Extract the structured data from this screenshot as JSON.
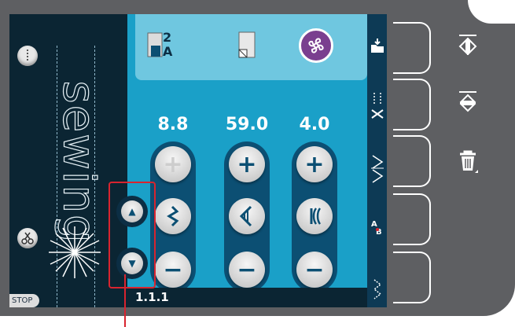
{
  "stitch_preview": {
    "sample_text": "sewing",
    "stop_label": "STOP"
  },
  "top_bar": {
    "program_icon_number": "2",
    "program_icon_letter": "A"
  },
  "settings": {
    "width": {
      "value": "8.8",
      "icon": "zigzag-width-icon"
    },
    "length": {
      "value": "59.0",
      "icon": "stitch-length-icon"
    },
    "tension": {
      "value": "4.0",
      "icon": "tension-icon"
    }
  },
  "footer": {
    "stitch_number": "1.1.1"
  },
  "sidebar": {
    "items": [
      "open-folder-icon",
      "scissors-cut-icon",
      "mirror-stitch-icon",
      "monogram-icon",
      "stitch-pattern-icon"
    ]
  },
  "hardware_buttons": [
    "mirror-side-icon",
    "mirror-end-icon",
    "trash-icon"
  ],
  "colors": {
    "screen_background": "#1aa0c8",
    "sidebar": "#0d3a55",
    "fan_button": "#7a3f8f",
    "highlight": "#d8242f"
  }
}
